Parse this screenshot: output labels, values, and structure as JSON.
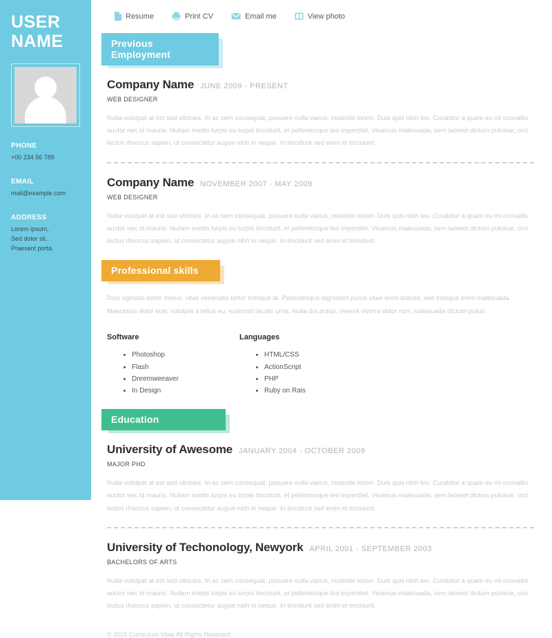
{
  "sidebar": {
    "user_name_line1": "USER",
    "user_name_line2": "NAME",
    "avatar_name": "avatar-placeholder",
    "contacts": [
      {
        "label": "PHONE",
        "value": "+00 234 56 789"
      },
      {
        "label": "EMAIL",
        "value": "mail@example.com"
      },
      {
        "label": "ADDRESS",
        "value": "Lorem ipsum,\nSed dolor sit,\nPraesent porta."
      }
    ],
    "background_color": "#6ecbe2"
  },
  "toolbar": {
    "items": [
      {
        "label": "Resume",
        "icon": "document-icon"
      },
      {
        "label": "Print CV",
        "icon": "printer-icon"
      },
      {
        "label": "Email me",
        "icon": "envelope-icon"
      },
      {
        "label": "View photo",
        "icon": "image-icon"
      }
    ]
  },
  "sections": {
    "employment": {
      "heading": "Previous Employment",
      "color": "#6ecbe2",
      "entries": [
        {
          "title": "Company Name",
          "date": "JUNE 2009 - PRESENT",
          "role": "WEB DESIGNER",
          "body": "Nulla volutpat at est sed ultricies. In ac sem consequat, posuere nulla varius, molestie lorem. Duis quis nibh leo. Curabitur a quam eu mi convallis auctor nec id mauris. Nullam mattis turpis eu turpis tincidunt, et pellentesque leo imperdiet. Vivamus malesuada, sem laoreet dictum pulvinar, orci lectus rhoncus sapien, ut consectetur augue nibh in neque. In tincidunt sed enim et tincidunt."
        },
        {
          "title": "Company Name",
          "date": "NOVEMBER 2007 - MAY 2009",
          "role": "WEB DESIGNER",
          "body": "Nulla volutpat at est sed ultricies. In ac sem consequat, posuere nulla varius, molestie lorem. Duis quis nibh leo. Curabitur a quam eu mi convallis auctor nec id mauris. Nullam mattis turpis eu turpis tincidunt, et pellentesque leo imperdiet. Vivamus malesuada, sem laoreet dictum pulvinar, orci lectus rhoncus sapien, ut consectetur augue nibh in neque. In tincidunt sed enim et tincidunt."
        }
      ]
    },
    "skills": {
      "heading": "Professional skills",
      "color": "#eeaa33",
      "intro": "Duis egestas tortor metus, vitae venenatis tortor tristique at. Pellentesque dignissim purus vitae enim blandit, sed tristique enim malesuada. Maecenas dolor erat, volutpat a tellus eu, euismod iaculis urna. Nulla dui purus, viverra viverra dolor non, malesuada dictum purus.",
      "columns": [
        {
          "title": "Software",
          "items": [
            "Photoshop",
            "Flash",
            "Dreemweeaver",
            "In Design"
          ]
        },
        {
          "title": "Languages",
          "items": [
            "HTML/CSS",
            "ActionScript",
            "PHP",
            "Ruby on Rais"
          ]
        }
      ]
    },
    "education": {
      "heading": "Education",
      "color": "#3fbf8f",
      "entries": [
        {
          "title": "University of Awesome",
          "date": "JANUARY 2004 - OCTOBER 2009",
          "role": "MAJOR PHD",
          "body": "Nulla volutpat at est sed ultricies. In ac sem consequat, posuere nulla varius, molestie lorem. Duis quis nibh leo. Curabitur a quam eu mi convallis auctor nec id mauris. Nullam mattis turpis eu turpis tincidunt, et pellentesque leo imperdiet. Vivamus malesuada, sem laoreet dictum pulvinar, orci lectus rhoncus sapien, ut consectetur augue nibh in neque. In tincidunt sed enim et tincidunt."
        },
        {
          "title": "University of Techonology, Newyork",
          "date": "APRIL 2001 - SEPTEMBER 2003",
          "role": "BACHELORS OF ARTS",
          "body": "Nulla volutpat at est sed ultricies. In ac sem consequat, posuere nulla varius, molestie lorem. Duis quis nibh leo. Curabitur a quam eu mi convallis auctor nec id mauris. Nullam mattis turpis eu turpis tincidunt, et pellentesque leo imperdiet. Vivamus malesuada, sem laoreet dictum pulvinar, orci lectus rhoncus sapien, ut consectetur augue nibh in neque. In tincidunt sed enim et tincidunt."
        }
      ]
    }
  },
  "footer": {
    "text": "© 2015 Curriculum Vitae All Rights Reseverd"
  }
}
